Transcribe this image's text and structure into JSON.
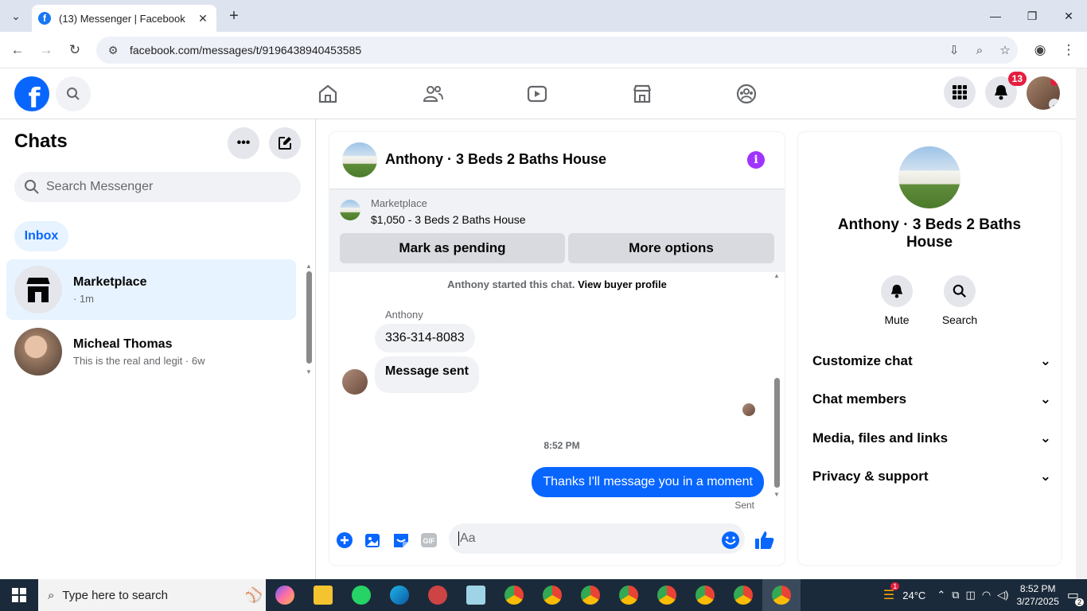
{
  "browser": {
    "tab_title": "(13) Messenger | Facebook",
    "url": "facebook.com/messages/t/9196438940453585"
  },
  "fb_header": {
    "notification_count": "13"
  },
  "left_panel": {
    "title": "Chats",
    "search_placeholder": "Search Messenger",
    "inbox_label": "Inbox",
    "chats": [
      {
        "name": "Marketplace",
        "preview": "· 1m",
        "active": true
      },
      {
        "name": "Micheal Thomas",
        "preview": "This is the real and legit · 6w",
        "active": false
      }
    ]
  },
  "conversation": {
    "title": "Anthony · 3 Beds 2 Baths House",
    "marketplace_label": "Marketplace",
    "listing": "$1,050 - 3 Beds 2 Baths House",
    "mark_pending_label": "Mark as pending",
    "more_options_label": "More options",
    "system_text": "Anthony started this chat.",
    "system_link": "View buyer profile",
    "sender": "Anthony",
    "incoming_messages": [
      "336-314-8083",
      "Message sent"
    ],
    "timestamp": "8:52 PM",
    "outgoing_message": "Thanks I'll message you in a moment",
    "sent_status": "Sent",
    "composer_placeholder": "Aa"
  },
  "details_panel": {
    "name": "Anthony · 3 Beds 2 Baths House",
    "mute_label": "Mute",
    "search_label": "Search",
    "sections": [
      "Customize chat",
      "Chat members",
      "Media, files and links",
      "Privacy & support"
    ]
  },
  "taskbar": {
    "search_placeholder": "Type here to search",
    "weather": "24°C",
    "weather_badge": "1",
    "time": "8:52 PM",
    "date": "3/27/2025",
    "notification_count": "2"
  },
  "colors": {
    "fb_blue": "#0866ff",
    "info_purple": "#a033ff",
    "badge_red": "#e41e3f"
  }
}
